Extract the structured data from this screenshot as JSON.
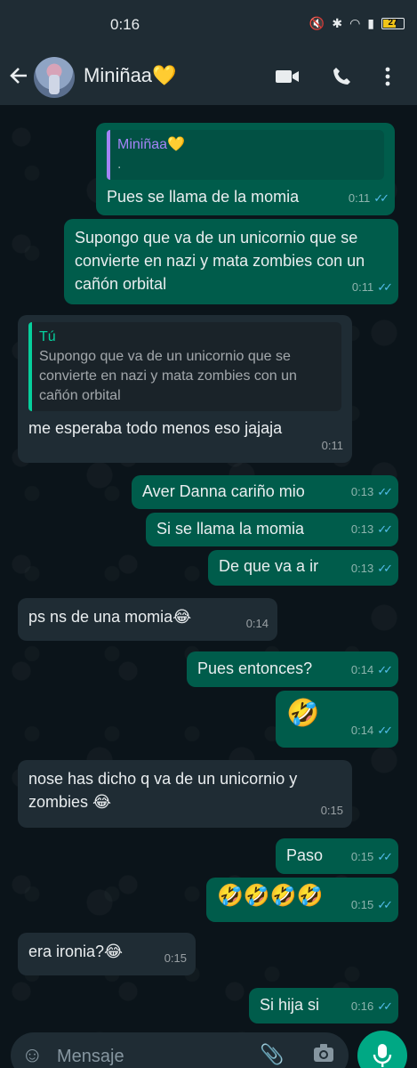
{
  "status_bar": {
    "time": "0:16",
    "battery": "27",
    "icons": [
      "mute-icon",
      "bluetooth-icon",
      "wifi-icon",
      "signal-icon"
    ]
  },
  "header": {
    "contact_name": "Miniñaa💛"
  },
  "messages": [
    {
      "dir": "out",
      "quote_name": "Miniñaa💛",
      "quote_text": ".",
      "text": "Pues se llama de la momia",
      "time": "0:11"
    },
    {
      "dir": "out",
      "text": "Supongo que va de un unicornio que se convierte en nazi y mata zombies con un cañón orbital",
      "time": "0:11"
    },
    {
      "dir": "in",
      "quote_name": "Tú",
      "quote_text": "Supongo que va de un unicornio que se convierte en nazi y mata zombies con un cañón orbital",
      "text": "me esperaba todo menos eso jajaja",
      "time": "0:11"
    },
    {
      "dir": "out",
      "text": "Aver Danna cariño mio",
      "time": "0:13"
    },
    {
      "dir": "out",
      "text": "Si se llama la momia",
      "time": "0:13"
    },
    {
      "dir": "out",
      "text": "De que va a ir",
      "time": "0:13"
    },
    {
      "dir": "in",
      "text": "ps ns de una momia😂",
      "time": "0:14"
    },
    {
      "dir": "out",
      "text": "Pues entonces?",
      "time": "0:14"
    },
    {
      "dir": "out",
      "text": "🤣",
      "time": "0:14"
    },
    {
      "dir": "in",
      "text": "nose has dicho q va de un unicornio y zombies 😂",
      "time": "0:15"
    },
    {
      "dir": "out",
      "text": "Paso",
      "time": "0:15"
    },
    {
      "dir": "out",
      "text": "🤣🤣🤣🤣",
      "time": "0:15"
    },
    {
      "dir": "in",
      "text": "era ironia?😂",
      "time": "0:15"
    },
    {
      "dir": "out",
      "text": "Si hija si",
      "time": "0:16"
    }
  ],
  "input": {
    "placeholder": "Mensaje"
  },
  "colors": {
    "outgoing": "#005c4b",
    "incoming": "#1f2c34",
    "background": "#0b141a",
    "read_ticks": "#53bdeb",
    "accent": "#00a884"
  }
}
